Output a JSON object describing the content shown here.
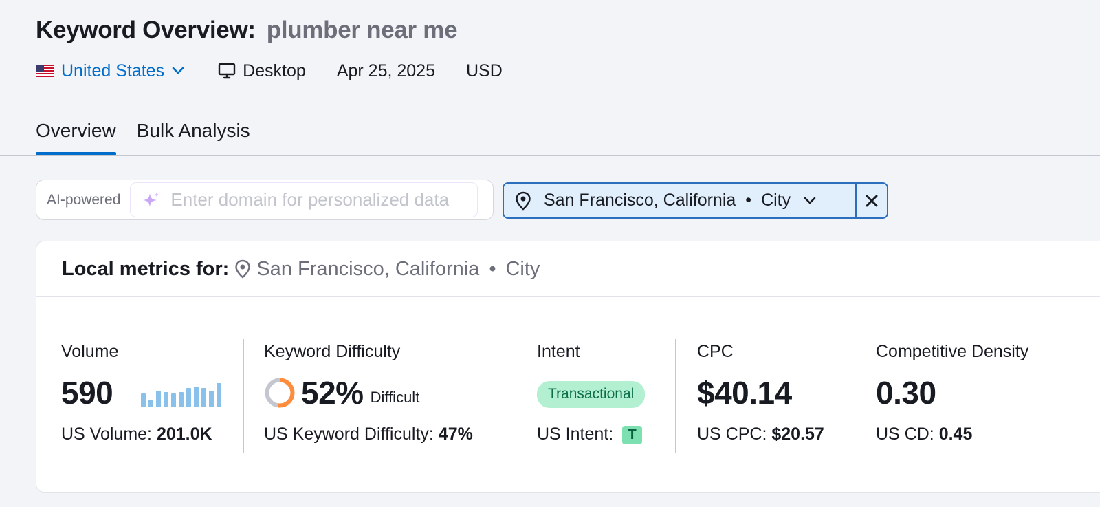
{
  "header": {
    "title": "Keyword Overview:",
    "keyword": "plumber near me"
  },
  "meta": {
    "country": "United States",
    "device": "Desktop",
    "date": "Apr 25, 2025",
    "currency": "USD"
  },
  "tabs": [
    {
      "label": "Overview",
      "active": true
    },
    {
      "label": "Bulk Analysis",
      "active": false
    }
  ],
  "ai": {
    "label": "AI-powered",
    "placeholder": "Enter domain for personalized data"
  },
  "location_filter": {
    "location": "San Francisco, California",
    "separator": "•",
    "type": "City"
  },
  "card": {
    "label": "Local metrics for:",
    "location": "San Francisco, California",
    "separator": "•",
    "type": "City"
  },
  "metrics": {
    "volume": {
      "label": "Volume",
      "value": "590",
      "trend": [
        0.5,
        0.25,
        0.6,
        0.55,
        0.5,
        0.55,
        0.7,
        0.75,
        0.7,
        0.6,
        0.9
      ],
      "sub_label": "US Volume:",
      "sub_value": "201.0K"
    },
    "kd": {
      "label": "Keyword Difficulty",
      "value": "52%",
      "percent": 52,
      "level": "Difficult",
      "sub_label": "US Keyword Difficulty:",
      "sub_value": "47%"
    },
    "intent": {
      "label": "Intent",
      "badge": "Transactional",
      "sub_label": "US Intent:",
      "sub_badge": "T"
    },
    "cpc": {
      "label": "CPC",
      "value": "$40.14",
      "sub_label": "US CPC:",
      "sub_value": "$20.57"
    },
    "cd": {
      "label": "Competitive Density",
      "value": "0.30",
      "sub_label": "US CD:",
      "sub_value": "0.45"
    }
  },
  "colors": {
    "accent": "#006dca",
    "intent_bg": "#b3f0d2",
    "kd_orange": "#ff8c3a",
    "bar_blue": "#89c1eb"
  }
}
